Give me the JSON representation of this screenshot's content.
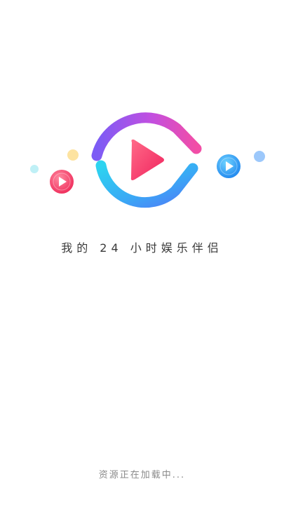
{
  "splash": {
    "tagline": "我的 24 小时娱乐伴侣",
    "loading_text": "资源正在加载中..."
  },
  "icons": {
    "main_logo": "play-logo-icon",
    "small_left": "play-bubble-icon",
    "small_right": "play-bubble-icon"
  },
  "colors": {
    "background": "#ffffff",
    "ring_purple": "#8b5cf6",
    "ring_pink": "#f24ea6",
    "ring_cyan": "#22d3ee",
    "ring_blue": "#3b82f6",
    "play_red": "#ff3b6b",
    "bubble_red": "#ff4d6d",
    "bubble_blue": "#2a9df4",
    "dot_yellow": "#fde68a",
    "dot_cyan": "#b6eef4",
    "dot_blue": "#93c5fd",
    "tagline_text": "#3a3a3a",
    "loading_text": "#8a8a8a"
  }
}
